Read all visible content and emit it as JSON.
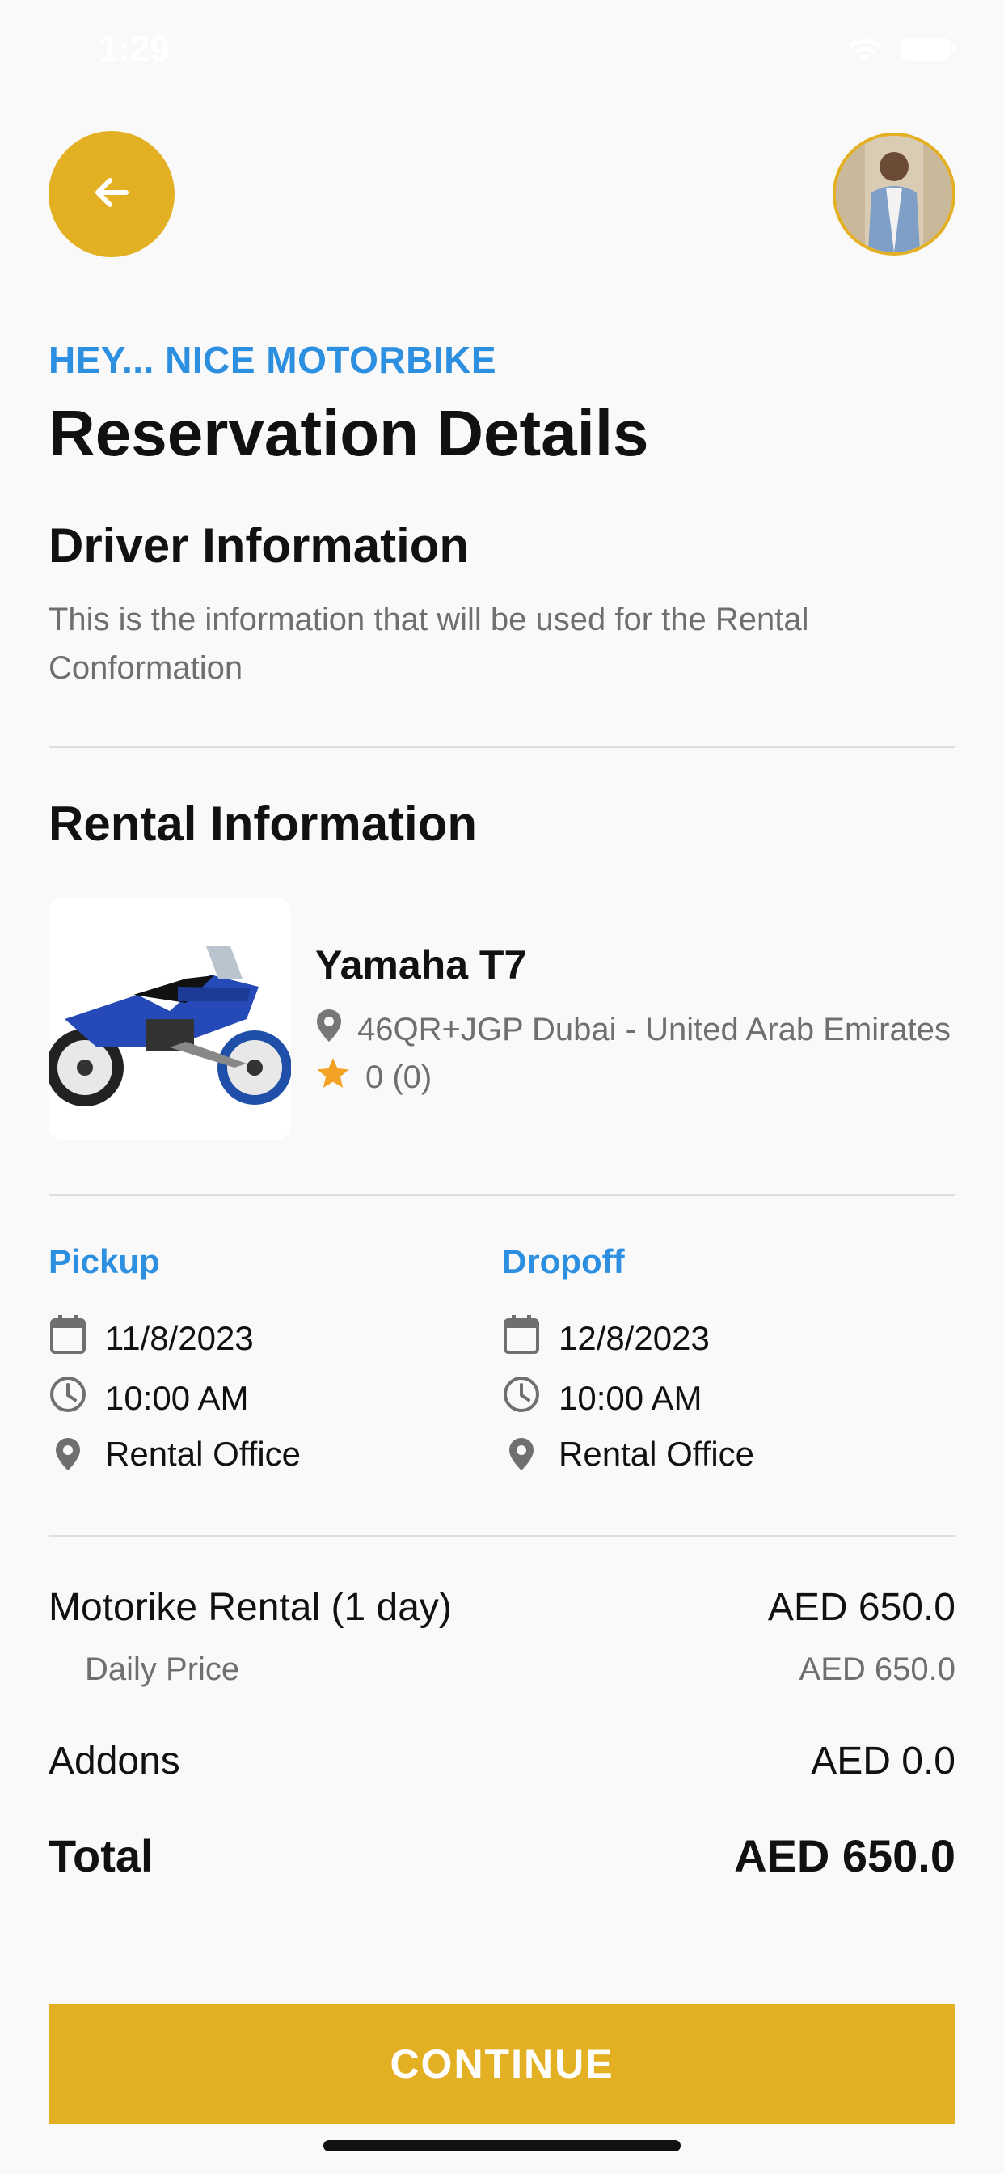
{
  "status_bar": {
    "time": "1:29"
  },
  "header": {
    "eyebrow": "HEY... NICE MOTORBIKE",
    "title": "Reservation Details"
  },
  "driver": {
    "title": "Driver Information",
    "description": "This is the information that will be used for the Rental Conformation"
  },
  "rental": {
    "title": "Rental Information",
    "bike": {
      "name": "Yamaha T7",
      "location": "46QR+JGP Dubai - United Arab Emirates",
      "rating": "0 (0)"
    }
  },
  "pickup": {
    "label": "Pickup",
    "date": "11/8/2023",
    "time": "10:00 AM",
    "place": "Rental Office"
  },
  "dropoff": {
    "label": "Dropoff",
    "date": "12/8/2023",
    "time": "10:00 AM",
    "place": "Rental Office"
  },
  "pricing": {
    "rental_label": "Motorike Rental (1 day)",
    "rental_value": "AED 650.0",
    "daily_label": "Daily Price",
    "daily_value": "AED 650.0",
    "addons_label": "Addons",
    "addons_value": "AED 0.0",
    "total_label": "Total",
    "total_value": "AED 650.0"
  },
  "actions": {
    "continue_label": "CONTINUE"
  },
  "colors": {
    "accent": "#e4b023",
    "link_blue": "#2c8fe0",
    "star": "#f2a325"
  },
  "icons": [
    "arrow-left-icon",
    "wifi-icon",
    "battery-icon",
    "location-pin-icon",
    "star-icon",
    "calendar-icon",
    "clock-icon"
  ]
}
